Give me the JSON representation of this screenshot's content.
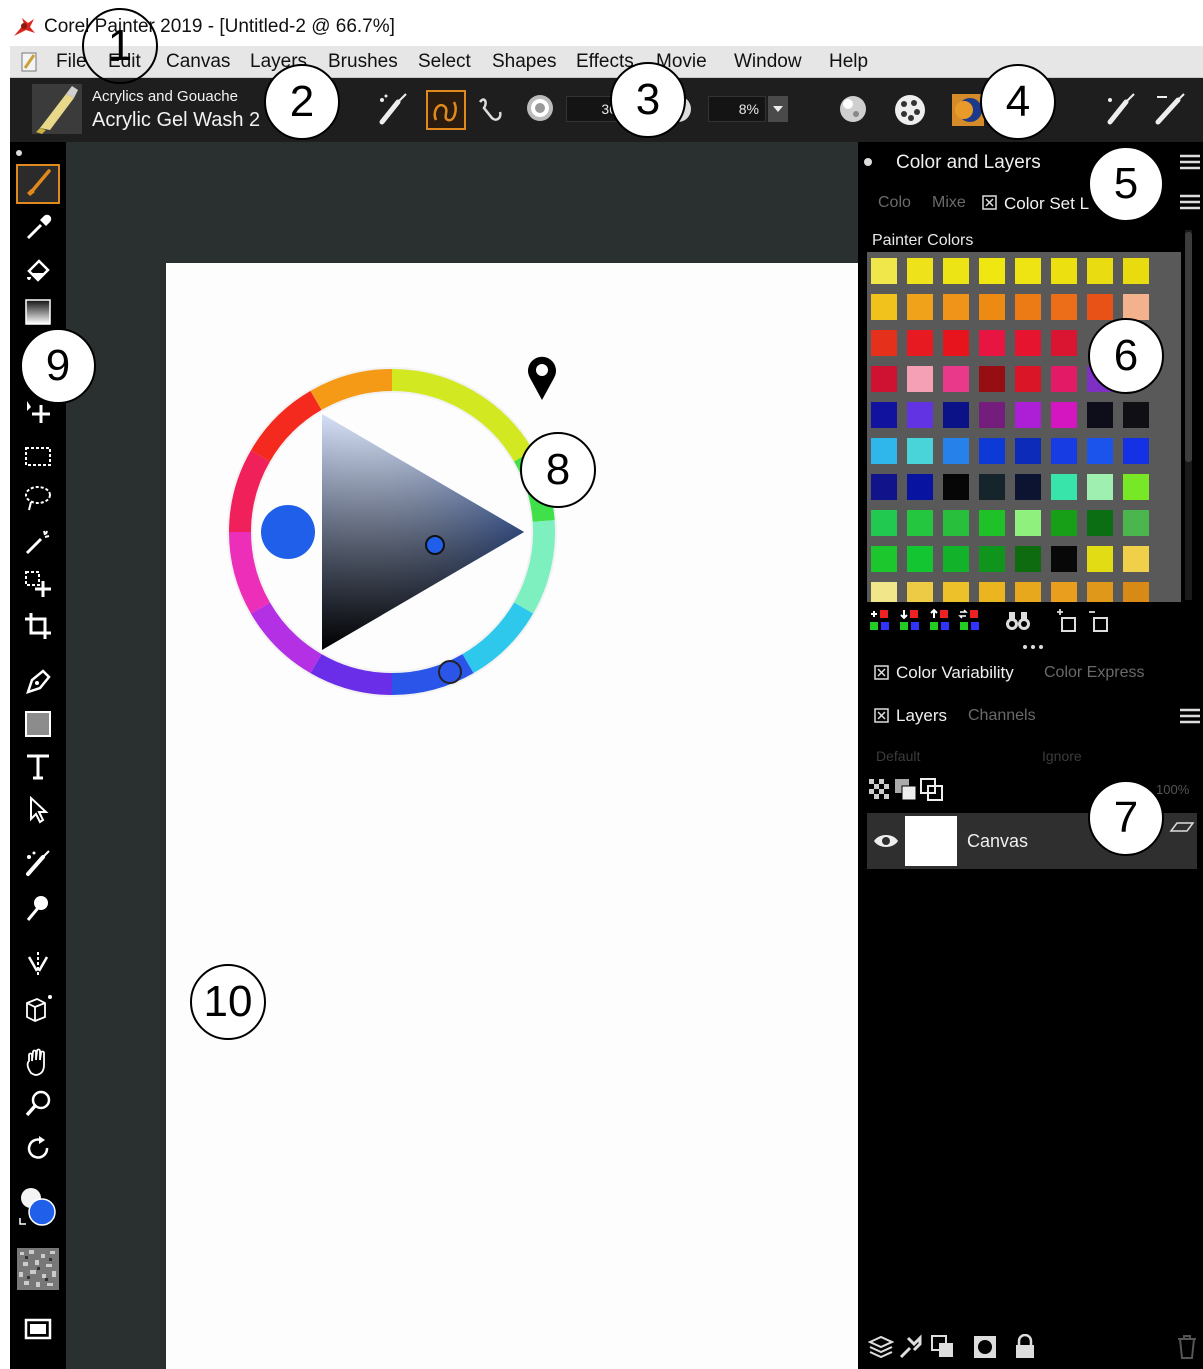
{
  "window": {
    "title": "Corel Painter 2019 - [Untitled-2 @ 66.7%]"
  },
  "menu": [
    "File",
    "Edit",
    "Canvas",
    "Layers",
    "Brushes",
    "Select",
    "Shapes",
    "Effects",
    "Movie",
    "Window",
    "Help"
  ],
  "property_bar": {
    "brush_category": "Acrylics and Gouache",
    "brush_variant": "Acrylic Gel Wash 2",
    "size_value": "30",
    "opacity_value": "8%"
  },
  "panel": {
    "title": "Color and Layers",
    "tabs": [
      "Colo",
      "Mixe",
      "Color Set L"
    ],
    "color_set_name": "Painter Colors",
    "swatches": [
      [
        "#f0e84a",
        "#eee21b",
        "#ece414",
        "#efe612",
        "#efe413",
        "#ece011",
        "#e9dd12",
        "#e8dc11"
      ],
      [
        "#f0c21b",
        "#f0a21b",
        "#ef9418",
        "#ed8a14",
        "#ec7b16",
        "#ec6e18",
        "#e85216",
        "#f3b28c"
      ],
      [
        "#e5301b",
        "#e81a21",
        "#e8141d",
        "#e81442",
        "#e6142e",
        "#d91531",
        null,
        null
      ],
      [
        "#cf1231",
        "#f5a0b4",
        "#e8398a",
        "#960d12",
        "#db1528",
        "#e31b66",
        "#7e2fc4",
        null
      ],
      [
        "#11129e",
        "#6233e2",
        "#0b1287",
        "#751d7c",
        "#ad1fd6",
        "#d316c0",
        "#0e0e1a",
        "#101014"
      ],
      [
        "#2fb6ea",
        "#49d4d9",
        "#2781ea",
        "#0d3ad6",
        "#0c2bb8",
        "#173ce4",
        "#1b54ec",
        "#1431e6"
      ],
      [
        "#10138a",
        "#0813a0",
        "#060606",
        "#16242c",
        "#0c1431",
        "#38e4a9",
        "#9ff0b0",
        "#78e826"
      ],
      [
        "#22c950",
        "#25c63f",
        "#28bf3c",
        "#1ec228",
        "#8ff07d",
        "#179f17",
        "#0c6e12",
        "#4bb64d"
      ],
      [
        "#1bc72c",
        "#14c532",
        "#12b22a",
        "#0f941c",
        "#0e6b10",
        "#080808",
        "#e1dc14",
        "#f0cf4a"
      ],
      [
        "#f1e689",
        "#eecb45",
        "#ecc12a",
        "#ebb51f",
        "#e8a81e",
        "#e99e1d",
        "#e0981b",
        "#d88a17"
      ]
    ],
    "color_variability_label": "Color Variability",
    "color_express_label": "Color Express",
    "layers_tab": "Layers",
    "channels_tab": "Channels",
    "composite_method": "Default",
    "preserve": "Ignore",
    "opacity": "100%",
    "layers": [
      {
        "name": "Canvas"
      }
    ]
  },
  "callouts": [
    "1",
    "2",
    "3",
    "4",
    "5",
    "6",
    "7",
    "8",
    "9",
    "10"
  ],
  "colors": {
    "accent": "#e08a1e",
    "main_color": "#1f5fea",
    "canvas": "#fdfdfd",
    "workspace": "#2a2f30"
  }
}
